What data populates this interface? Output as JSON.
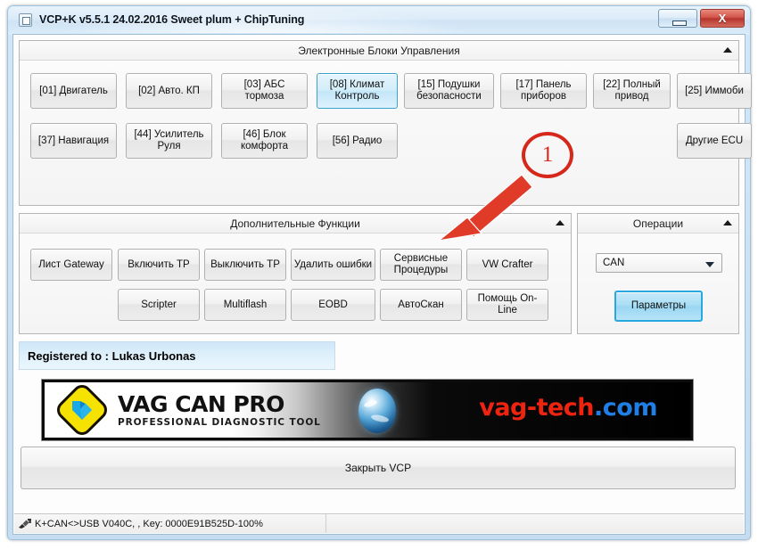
{
  "window": {
    "title": "VCP+K v5.5.1 24.02.2016 Sweet plum + ChipTuning",
    "system_icon": "window-icon",
    "minimize_label": "",
    "close_label": "X"
  },
  "panels": {
    "ecu": {
      "caption": "Электронные Блоки Управления",
      "collapse_icon": "collapse-up-icon",
      "row1": [
        {
          "label": "[01] Двигатель",
          "selected": false
        },
        {
          "label": "[02] Авто. КП",
          "selected": false
        },
        {
          "label": "[03] АБС тормоза",
          "selected": false
        },
        {
          "label": "[08] Климат\nКонтроль",
          "selected": true
        },
        {
          "label": "[15] Подушки\nбезопасности",
          "selected": false
        },
        {
          "label": "[17] Панель\nприборов",
          "selected": false
        },
        {
          "label": "[22] Полный\nпривод",
          "selected": false
        },
        {
          "label": "[25] Иммоби",
          "selected": false
        }
      ],
      "row2": [
        {
          "label": "[37] Навигация",
          "selected": false
        },
        {
          "label": "[44] Усилитель\nРуля",
          "selected": false
        },
        {
          "label": "[46] Блок\nкомфорта",
          "selected": false
        },
        {
          "label": "[56] Радио",
          "selected": false
        }
      ],
      "other_ecu": "Другие ECU"
    },
    "extra": {
      "caption": "Дополнительные Функции",
      "collapse_icon": "collapse-up-icon",
      "row1": [
        "Лист Gateway",
        "Включить ТР",
        "Выключить ТР",
        "Удалить ошибки",
        "Сервисные\nПроцедуры",
        "VW Crafter"
      ],
      "row2": [
        "Scripter",
        "Multiflash",
        "EOBD",
        "АвтоСкан",
        "Помощь On-Line"
      ]
    },
    "operations": {
      "caption": "Операции",
      "collapse_icon": "collapse-up-icon",
      "protocol_value": "CAN",
      "protocol_arrow": "chevron-down-icon",
      "parameters_label": "Параметры"
    }
  },
  "registration": {
    "text": "Registered to : Lukas Urbonas"
  },
  "banner": {
    "brand_line1": "VAG CAN PRO",
    "brand_line2": "PROFESSIONAL DIAGNOSTIC TOOL",
    "site_name": "vag-tech",
    "site_tld": ".com",
    "logo_icon": "vag-diamond-arrow-icon",
    "globe_icon": "globe-icon"
  },
  "footer": {
    "close_button": "Закрыть VCP"
  },
  "statusbar": {
    "connection_icon": "plug-icon",
    "text": "K+CAN<>USB V040C, , Key: 0000E91B525D-100%"
  },
  "annotation": {
    "step_number": "1",
    "arrow_icon": "red-arrow-icon",
    "color": "#d5281b"
  },
  "colors": {
    "accent_blue": "#28a8e0",
    "selected_button": "#c3e6f8",
    "annotation_red": "#d5281b",
    "site_red": "#ee2411",
    "site_blue": "#1f7fe5",
    "logo_yellow": "#f5e200"
  }
}
